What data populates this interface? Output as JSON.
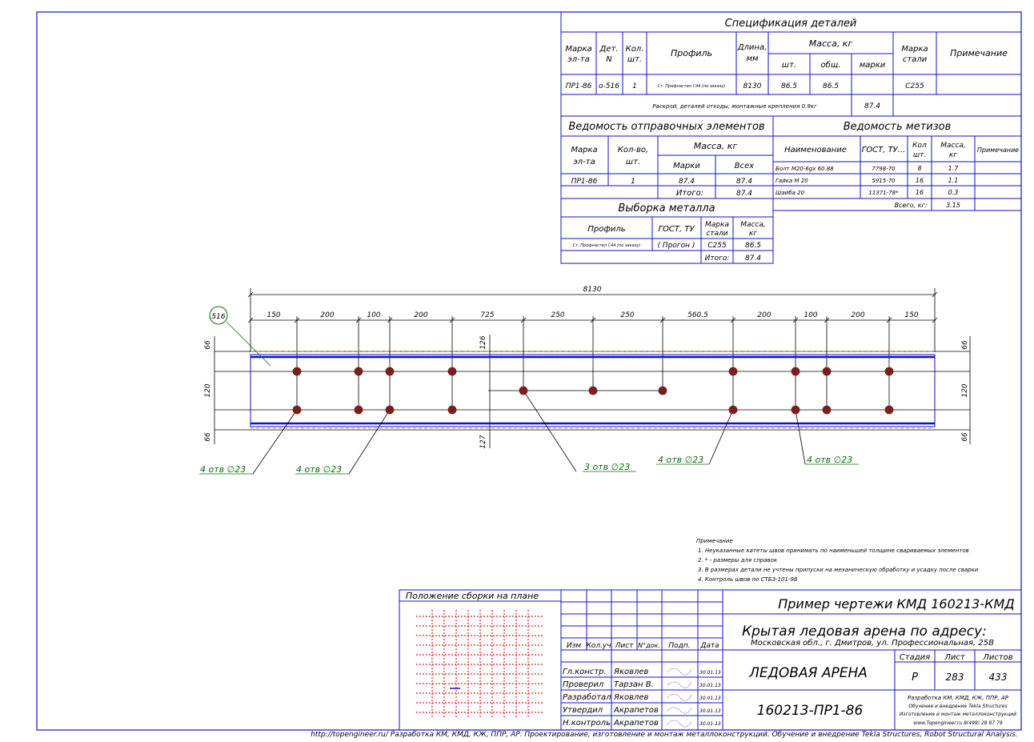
{
  "spec": {
    "title": "Спецификация деталей",
    "headers": {
      "marka": [
        "Марка",
        "эл-та"
      ],
      "det": [
        "Дет.",
        "N"
      ],
      "kol": [
        "Кол.",
        "шт."
      ],
      "profile": "Профиль",
      "length": [
        "Длина,",
        "мм"
      ],
      "mass": "Масса, кг",
      "mass_sht": "шт.",
      "mass_obsch": "общ.",
      "mass_marki": "марки",
      "steel": [
        "Марка",
        "стали"
      ],
      "note": "Примечание"
    },
    "row": {
      "marka": "ПР1-86",
      "det": "о-516",
      "kol": "1",
      "profile": "Ст. Профнастил С44 (по заказу)",
      "length": "8130",
      "mass_sht": "86.5",
      "mass_obsch": "86.5",
      "steel": "С255"
    },
    "extra": {
      "text": "Раскрой, деталей отходы, монтажные крепления 0.9кг",
      "value": "87.4"
    }
  },
  "shipping": {
    "title": "Ведомость отправочных элементов",
    "headers": {
      "marka": [
        "Марка",
        "эл-та"
      ],
      "kol": [
        "Кол-во,",
        "шт."
      ],
      "mass": "Масса, кг",
      "marki": "Марки",
      "all": "Всех"
    },
    "row": {
      "marka": "ПР1-86",
      "kol": "1",
      "marki": "87.4",
      "all": "87.4"
    },
    "total_label": "Итого:",
    "total": "87.4"
  },
  "hardware": {
    "title": "Ведомость метизов",
    "headers": {
      "name": "Наименование",
      "gost": "ГОСТ, ТУ...",
      "kol": [
        "Кол",
        "шт."
      ],
      "mass": [
        "Масса,",
        "кг"
      ],
      "note": "Примечание"
    },
    "rows": [
      {
        "name": "Болт М20-6gх 60.88",
        "gost": "7798-70",
        "kol": "8",
        "mass": "1.7"
      },
      {
        "name": "Гайка М 20",
        "gost": "5915-70",
        "kol": "16",
        "mass": "1.1"
      },
      {
        "name": "Шайба 20",
        "gost": "11371-78*",
        "kol": "16",
        "mass": "0.3"
      }
    ],
    "total_label": "Всего, кг:",
    "total": "3.15"
  },
  "metal": {
    "title": "Выборка металла",
    "headers": {
      "profile": "Профиль",
      "gost": "ГОСТ, ТУ",
      "steel": [
        "Марка",
        "стали"
      ],
      "mass": [
        "Масса,",
        "кг"
      ]
    },
    "row": {
      "profile": "Ст. Профнастил С44 (по заказу)",
      "gost": "( Прогон )",
      "steel": "С255",
      "mass": "86.5"
    },
    "total_label": "Итого:",
    "total": "87.4"
  },
  "drawing": {
    "overall": "8130",
    "dims": [
      "150",
      "200",
      "100",
      "200",
      "725",
      "250",
      "250",
      "560.5",
      "200",
      "100",
      "200",
      "150"
    ],
    "left_v": [
      "66",
      "120",
      "66"
    ],
    "right_v": [
      "66",
      "120",
      "66"
    ],
    "mid_v": [
      "126",
      "127"
    ],
    "part_tag": "516",
    "callouts": [
      "4 отв ∅23",
      "4 отв ∅23",
      "3 отв ∅23",
      "4 отв ∅23",
      "4 отв ∅23"
    ]
  },
  "notes": {
    "title": "Примечание",
    "items": [
      "1. Неуказанные катеты швов принимать по наименьшей толщине свариваемых элементов",
      "2. * - размеры для справок",
      "3. В размерах детали не учтены припуски на механическую обработку и усадку после сварки",
      "4. Контроль швов по СТБ3-101-98"
    ]
  },
  "titleblock": {
    "plan_label": "Положение сборки на плане",
    "col_heads": [
      "Изм",
      "Кол.уч",
      "Лист",
      "N°док.",
      "Подп.",
      "Дата"
    ],
    "roles": [
      {
        "role": "Гл.констр.",
        "name": "Яковлев",
        "date": "30.01.13"
      },
      {
        "role": "Проверил",
        "name": "Тарзан В.",
        "date": "30.01.13"
      },
      {
        "role": "Разработал",
        "name": "Яковлев",
        "date": "30.01.13"
      },
      {
        "role": "Утвердил",
        "name": "Акрапетов",
        "date": "30.01.13"
      },
      {
        "role": "Н.контроль",
        "name": "Акрапетов",
        "date": "30.01.13"
      }
    ],
    "example": "Пример чертежи КМД  160213-КМД",
    "project": "Крытая ледовая арена по адресу:",
    "address": "Московская обл., г. Дмитров, ул. Профессиональная, 25В",
    "object": "ЛЕДОВАЯ АРЕНА",
    "stage_label": "Стадия",
    "sheet_label": "Лист",
    "sheets_label": "Листов",
    "stage": "Р",
    "sheet": "283",
    "sheets": "433",
    "code": "160213-ПР1-86",
    "company": [
      "Разработка КМ, КМД, КЖ, ППР, АР",
      "Обучение и внедрение Tekla Structures",
      "Изготовление и монтаж металлоконструкций",
      "www.Topengineer.ru       8(499) 28 87 79"
    ]
  },
  "footer": "http://topengineer.ru/  Разработка КМ, КМД, КЖ, ППР, АР. Проектирование, изготовление и монтаж металлоконструкций. Обучение и внедрение Tekla Structures, Robot Structural Analysis."
}
